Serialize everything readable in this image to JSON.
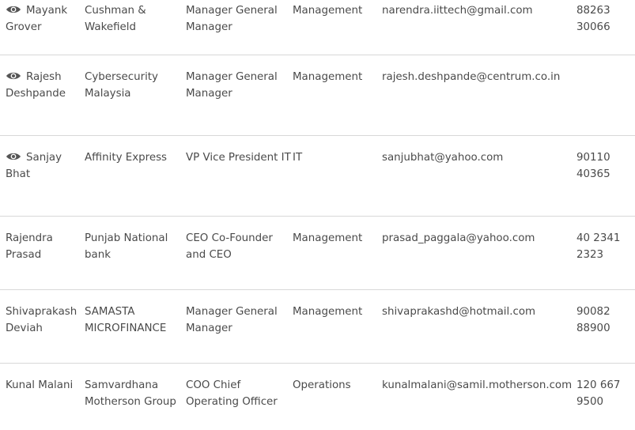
{
  "contacts": [
    {
      "name_line1": "Mayank",
      "name_line2": "Grover",
      "has_view_icon": true,
      "company": "Cushman & Wakefield",
      "designation": "Manager General Manager",
      "department": "Management",
      "email": "narendra.iittech@gmail.com",
      "phone": "88263 30066"
    },
    {
      "name_line1": "Rajesh",
      "name_line2": "Deshpande",
      "has_view_icon": true,
      "company": "Cybersecurity Malaysia",
      "designation": "Manager General Manager",
      "department": "Management",
      "email": "rajesh.deshpande@centrum.co.in",
      "phone": ""
    },
    {
      "name_line1": "Sanjay",
      "name_line2": "Bhat",
      "has_view_icon": true,
      "company": "Affinity Express",
      "designation": "VP Vice President IT",
      "department": "IT",
      "email": "sanjubhat@yahoo.com",
      "phone": "90110 40365"
    },
    {
      "name_line1": "Rajendra",
      "name_line2": "Prasad",
      "has_view_icon": false,
      "company": "Punjab National bank",
      "designation": "CEO Co-Founder and CEO",
      "department": "Management",
      "email": "prasad_paggala@yahoo.com",
      "phone": "40 2341 2323"
    },
    {
      "name_line1": "Shivaprakash",
      "name_line2": "Deviah",
      "has_view_icon": false,
      "company": "SAMASTA MICROFINANCE",
      "designation": "Manager General Manager",
      "department": "Management",
      "email": "shivaprakashd@hotmail.com",
      "phone": "90082 88900"
    },
    {
      "name_line1": "Kunal Malani",
      "name_line2": "",
      "has_view_icon": false,
      "company": "Samvardhana Motherson Group",
      "designation": "COO Chief Operating Officer",
      "department": "Operations",
      "email": "kunalmalani@samil.motherson.com",
      "phone": "120 667 9500"
    }
  ],
  "icons": {
    "view": "eye-icon"
  },
  "colors": {
    "text": "#4a4a4a",
    "divider": "#d8d8d8",
    "icon": "#555555"
  }
}
